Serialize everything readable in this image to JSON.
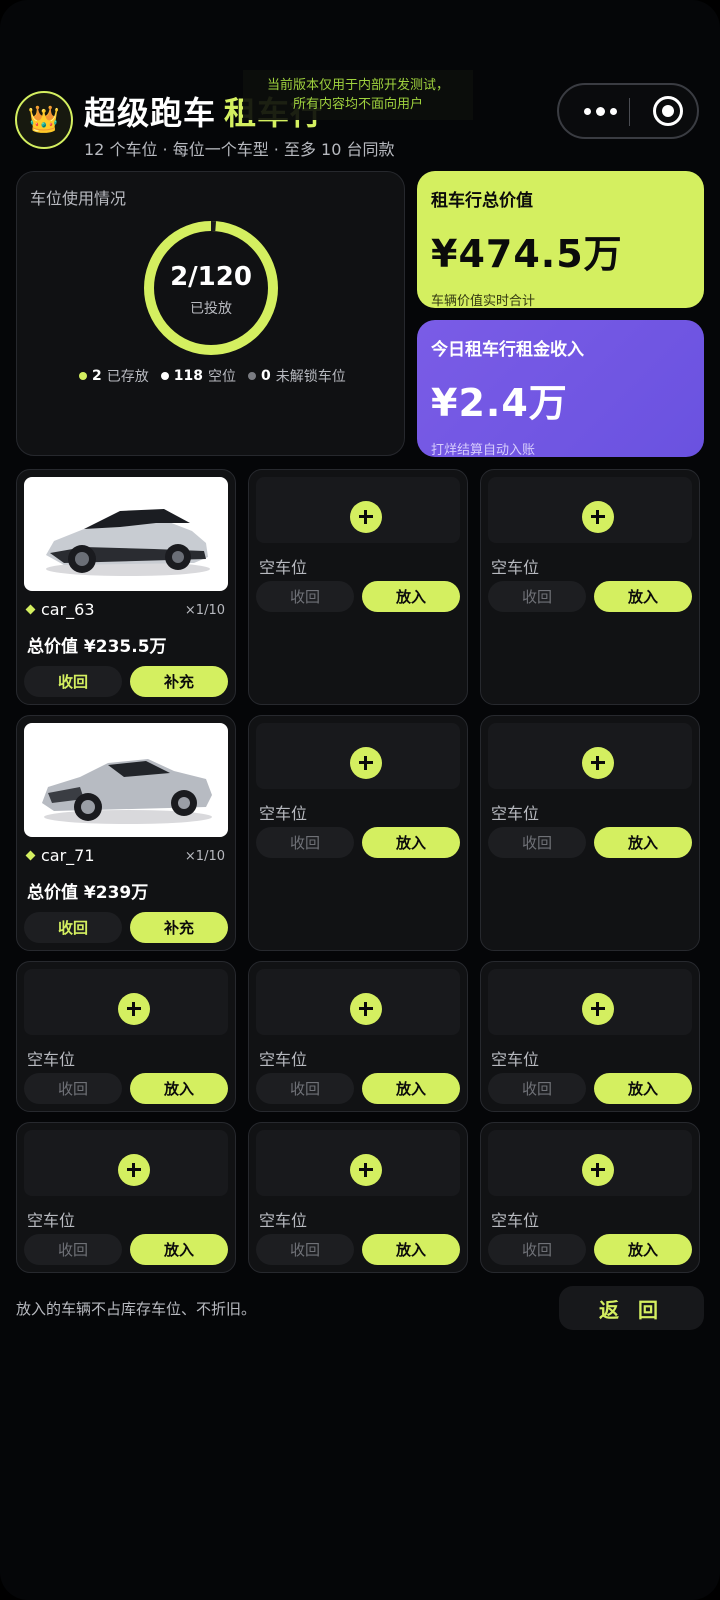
{
  "header": {
    "title": "超级跑车",
    "title_accent": "租车行",
    "subtitle": "12 个车位 · 每位一个车型 · 至多 10 台同款",
    "dev_notice_line1": "当前版本仅用于内部开发测试，",
    "dev_notice_line2": "所有内容均不面向用户",
    "avatar_icon": "crown-icon"
  },
  "usage": {
    "title": "车位使用情况",
    "ring_value": "2/120",
    "ring_label": "已投放",
    "ring_fraction": 0.0167,
    "legend": [
      {
        "count": "2",
        "label": "已存放",
        "color": "#d4ef60"
      },
      {
        "count": "118",
        "label": "空位",
        "color": "#ffffff"
      },
      {
        "count": "0",
        "label": "未解锁车位",
        "color": "#7a7c82"
      }
    ]
  },
  "total_value": {
    "label": "租车行总价值",
    "value": "¥474.5万",
    "note": "车辆价值实时合计"
  },
  "income": {
    "label": "今日租车行租金收入",
    "value": "¥2.4万",
    "note": "打烊结算自动入账"
  },
  "slots": {
    "empty_label": "空车位",
    "recall_label": "收回",
    "place_label": "放入",
    "refill_label": "补充",
    "cars": [
      {
        "name": "car_63",
        "count": "×1/10",
        "value": "总价值 ¥235.5万"
      },
      {
        "name": "car_71",
        "count": "×1/10",
        "value": "总价值 ¥239万"
      }
    ]
  },
  "footer": {
    "note": "放入的车辆不占库存车位、不折旧。",
    "back_label": "返 回"
  },
  "colors": {
    "accent": "#d4ef60",
    "purple": "#6a52e0",
    "background": "#050608"
  }
}
